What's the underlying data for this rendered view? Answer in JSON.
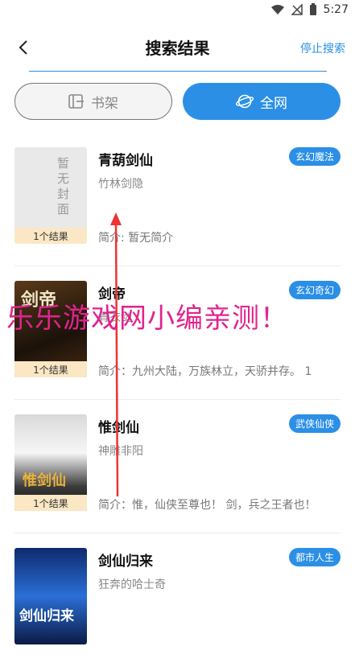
{
  "status": {
    "time": "5:27"
  },
  "header": {
    "title": "搜索结果",
    "stop_label": "停止搜索"
  },
  "tabs": [
    {
      "label": "书架",
      "active": false
    },
    {
      "label": "全网",
      "active": true
    }
  ],
  "books": [
    {
      "title": "青葫剑仙",
      "author": "竹林剑隐",
      "tag": "玄幻魔法",
      "intro": "简介: 暂无简介",
      "results": "1个结果",
      "cover_text": "暂无封面"
    },
    {
      "title": "剑帝",
      "author": "青衣剑",
      "tag": "玄幻奇幻",
      "intro": "简介：九州大陆，万族林立，天骄并存。 1",
      "results": "1个结果",
      "cover_text": "剑帝"
    },
    {
      "title": "惟剑仙",
      "author": "神雕非阳",
      "tag": "武侠仙侠",
      "intro": "简介：惟，仙侠至尊也！  剑，兵之王者也！",
      "results": "1个结果",
      "cover_text": "惟剑仙"
    },
    {
      "title": "剑仙归来",
      "author": "狂奔的哈士奇",
      "tag": "都市人生",
      "intro": "",
      "results": "",
      "cover_text": "剑仙归来"
    }
  ],
  "watermark": "乐乐游戏网小编亲测！",
  "colors": {
    "accent": "#2b8fe6",
    "watermark": "#e0248e"
  }
}
